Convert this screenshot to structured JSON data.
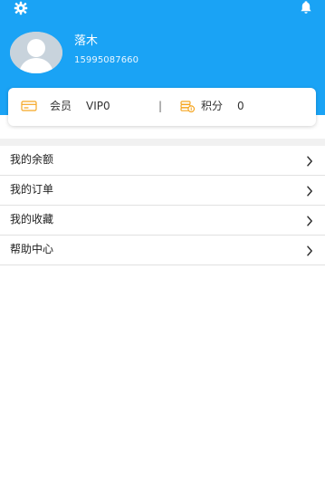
{
  "profile": {
    "name": "落木",
    "phone": "15995087660"
  },
  "card": {
    "member_label": "会员",
    "member_value": "VIP0",
    "separator": "|",
    "points_label": "积分",
    "points_value": "0"
  },
  "menu": [
    {
      "label": "我的余额"
    },
    {
      "label": "我的订单"
    },
    {
      "label": "我的收藏"
    },
    {
      "label": "帮助中心"
    }
  ],
  "colors": {
    "header_blue": "#1aa3f5",
    "card_icon_orange": "#f5a623",
    "divider": "#e1e1e1",
    "text_dark": "#222222"
  },
  "icons": {
    "settings": "gear-icon",
    "notifications": "bell-icon",
    "avatar": "default-user-avatar",
    "member": "card-icon",
    "points": "coin-stack-icon",
    "chevron": "chevron-right-icon"
  }
}
